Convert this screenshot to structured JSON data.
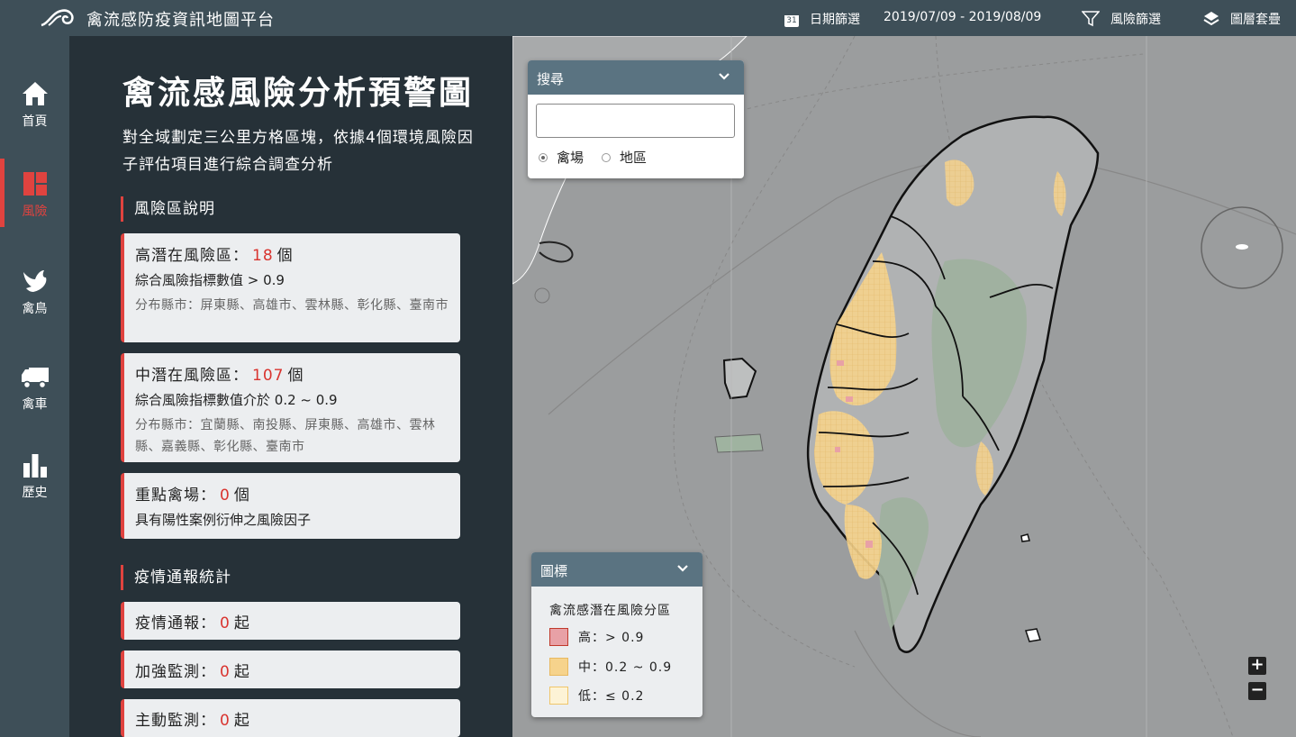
{
  "header": {
    "title": "禽流感防疫資訊地圖平台",
    "date_icon_text": "31",
    "date_filter_label": "日期篩選",
    "date_range": "2019/07/09 - 2019/08/09",
    "risk_filter_label": "風險篩選",
    "layer_label": "圖層套疊"
  },
  "sidebar": {
    "items": [
      {
        "label": "首頁",
        "icon": "home-icon"
      },
      {
        "label": "風險",
        "icon": "risk-icon",
        "active": true
      },
      {
        "label": "禽鳥",
        "icon": "bird-icon"
      },
      {
        "label": "禽車",
        "icon": "truck-icon"
      },
      {
        "label": "歷史",
        "icon": "bar-chart-icon"
      }
    ]
  },
  "panel": {
    "title": "禽流感風險分析預警圖",
    "description": "對全域劃定三公里方格區塊，依據4個環境風險因子評估項目進行綜合調查分析",
    "risk_section": "風險區說明",
    "cards": [
      {
        "title": "高潛在風險區：",
        "count": "18",
        "unit": "個",
        "sub": "綜合風險指標數值 > 0.9",
        "detail": "分布縣市：屏東縣、高雄市、雲林縣、彰化縣、臺南市"
      },
      {
        "title": "中潛在風險區：",
        "count": "107",
        "unit": "個",
        "sub": "綜合風險指標數值介於 0.2 ~ 0.9",
        "detail": "分布縣市：宜蘭縣、南投縣、屏東縣、高雄市、雲林縣、嘉義縣、彰化縣、臺南市"
      },
      {
        "title": "重點禽場：",
        "count": "0",
        "unit": "個",
        "sub": "具有陽性案例衍伸之風險因子"
      }
    ],
    "stats_section": "疫情通報統計",
    "stats": [
      {
        "title": "疫情通報：",
        "count": "0",
        "unit": "起"
      },
      {
        "title": "加強監測：",
        "count": "0",
        "unit": "起"
      },
      {
        "title": "主動監測：",
        "count": "0",
        "unit": "起"
      }
    ]
  },
  "search": {
    "header": "搜尋",
    "value": "",
    "option_farm": "禽場",
    "option_area": "地區",
    "selected": "禽場"
  },
  "legend": {
    "header": "圖標",
    "title": "禽流感潛在風險分區",
    "high": "高：> 0.9",
    "mid": "中：0.2 ~ 0.9",
    "low": "低：≤ 0.2",
    "colors": {
      "high": "#e8a1a6",
      "mid": "#f6d38c",
      "low": "#fdf3d6"
    }
  },
  "map": {
    "zoom_in": "+",
    "zoom_out": "−"
  }
}
